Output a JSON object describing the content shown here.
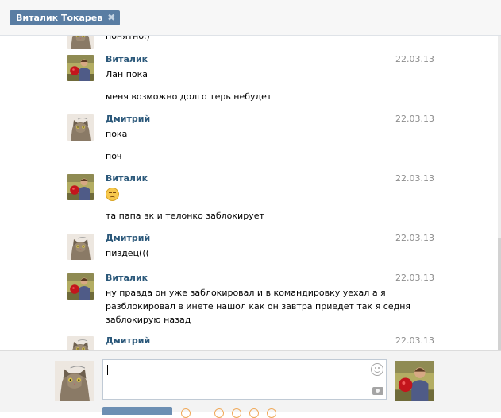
{
  "header": {
    "tab_label": "Виталик Токарев",
    "close_glyph": "✖"
  },
  "messages": [
    {
      "author": "",
      "date": "",
      "lines": [
        "понятно.)"
      ]
    },
    {
      "author": "Виталик",
      "date": "22.03.13",
      "lines": [
        "Лан пока",
        "меня возможно долго терь небудет"
      ]
    },
    {
      "author": "Дмитрий",
      "date": "22.03.13",
      "lines": [
        "пока",
        "поч"
      ]
    },
    {
      "author": "Виталик",
      "date": "22.03.13",
      "lines": [
        "",
        "та папа вк и телонко заблокирует"
      ]
    },
    {
      "author": "Дмитрий",
      "date": "22.03.13",
      "lines": [
        "пиздец((("
      ]
    },
    {
      "author": "Виталик",
      "date": "22.03.13",
      "lines": [
        "ну правда он уже заблокировал и в командировку уехал а я",
        "разблокировал в инете нашол как он завтра приедет так я седня",
        "заблокирую назад"
      ]
    },
    {
      "author": "Дмитрий",
      "date": "22.03.13",
      "lines": []
    }
  ],
  "composer": {
    "value": "",
    "placeholder": ""
  },
  "icons": {
    "emoji": "sad-smiley-icon",
    "smile_button": "smiley-icon",
    "camera_button": "camera-icon"
  },
  "colors": {
    "accent": "#597da3",
    "author": "#2b587a",
    "date": "#8d8d8d",
    "format_icons": "#f0a95a"
  }
}
